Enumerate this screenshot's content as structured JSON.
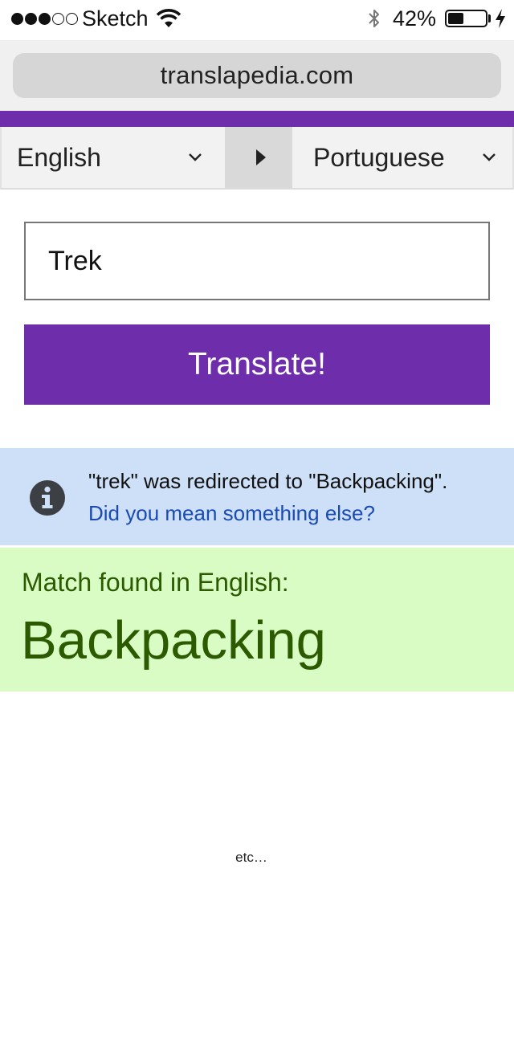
{
  "status_bar": {
    "signal_dots": [
      true,
      true,
      true,
      false,
      false
    ],
    "carrier": "Sketch",
    "wifi_icon": "wifi-icon",
    "bluetooth_icon": "bluetooth-icon",
    "battery_percent": "42%",
    "battery_level": 0.42,
    "charging_icon": "bolt-icon"
  },
  "browser": {
    "url": "translapedia.com"
  },
  "colors": {
    "brand_purple": "#6e2eac",
    "notice_bg": "#cde0f7",
    "match_bg": "#d9fcc4",
    "match_text": "#2c5a00",
    "link": "#1a4bb2"
  },
  "language_selector": {
    "from": "English",
    "to": "Portuguese",
    "swap_icon": "triangle-right-icon"
  },
  "search": {
    "value": "Trek",
    "button_label": "Translate!"
  },
  "redirect_notice": {
    "icon": "info-icon",
    "message": "\"trek\" was redirected to \"Backpacking\".",
    "link_text": "Did you mean something else?"
  },
  "match": {
    "label": "Match found in English:",
    "word": "Backpacking"
  },
  "footer": {
    "etc": "etc…"
  }
}
